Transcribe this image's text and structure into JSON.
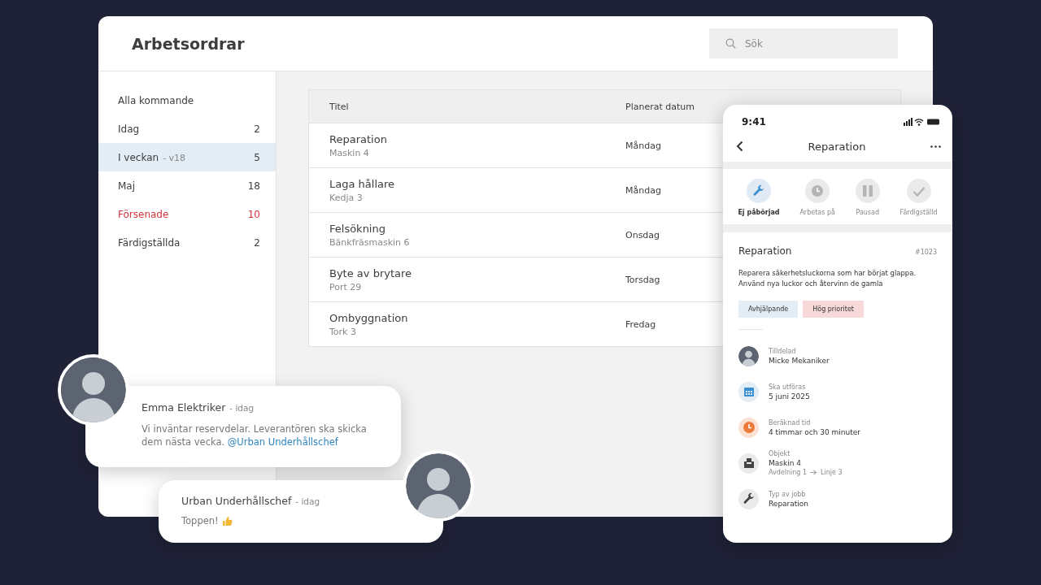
{
  "window": {
    "title": "Arbetsordrar"
  },
  "search": {
    "placeholder": "Sök"
  },
  "sidebar": {
    "items": [
      {
        "label": "Alla kommande",
        "selected": false,
        "overdue": false
      },
      {
        "label": "Idag",
        "count": "2",
        "selected": false,
        "overdue": false
      },
      {
        "label": "I veckan",
        "suffix": "- v18",
        "count": "5",
        "selected": true,
        "overdue": false
      },
      {
        "label": "Maj",
        "count": "18",
        "selected": false,
        "overdue": false
      },
      {
        "label": "Försenade",
        "count": "10",
        "selected": false,
        "overdue": true
      },
      {
        "label": "Färdigställda",
        "count": "2",
        "selected": false,
        "overdue": false
      }
    ]
  },
  "table": {
    "columns": [
      "Titel",
      "Planerat datum"
    ],
    "rows": [
      {
        "title": "Reparation",
        "object": "Maskin 4",
        "date": "Måndag"
      },
      {
        "title": "Laga hållare",
        "object": "Kedja 3",
        "date": "Måndag"
      },
      {
        "title": "Felsökning",
        "object": "Bänkfräsmaskin 6",
        "date": "Onsdag"
      },
      {
        "title": "Byte av brytare",
        "object": "Port 29",
        "date": "Torsdag"
      },
      {
        "title": "Ombyggnation",
        "object": "Tork 3",
        "date": "Fredag"
      }
    ]
  },
  "phone": {
    "time": "9:41",
    "title": "Reparation",
    "statuses": [
      {
        "kind": "wrench",
        "label": "Ej påbörjad",
        "selected": true
      },
      {
        "kind": "clock",
        "label": "Arbetas på",
        "selected": false
      },
      {
        "kind": "pause",
        "label": "Pausad",
        "selected": false
      },
      {
        "kind": "check",
        "label": "Färdigställd",
        "selected": false
      }
    ],
    "order": {
      "title": "Reparation",
      "number": "#1023",
      "description": "Reparera säkerhetsluckorna som har börjat glappa. Använd nya luckor och återvinn de gamla",
      "tags": [
        {
          "label": "Avhjälpande",
          "color": "#e3edf5"
        },
        {
          "label": "Hög prioritet",
          "color": "#f8d9da"
        }
      ]
    },
    "details": [
      {
        "kind": "person",
        "label": "Tilldelad",
        "value": "Micke Mekaniker"
      },
      {
        "kind": "calendar",
        "label": "Ska utföras",
        "value": "5 juni 2025"
      },
      {
        "kind": "clock",
        "label": "Beräknad tid",
        "value": "4 timmar och 30 minuter"
      },
      {
        "kind": "box",
        "label": "Objekt",
        "value": "Maskin 4",
        "path": [
          "Avdelning 1",
          "Linje 3"
        ]
      },
      {
        "kind": "wrench",
        "label": "Typ av jobb",
        "value": "Reparation"
      }
    ]
  },
  "comments": [
    {
      "author": "Emma Elektriker",
      "time": "- idag",
      "text": "Vi inväntar reservdelar. Leverantören ska skicka dem nästa vecka.",
      "mention": "@Urban Underhållschef",
      "thumbs_up": false
    },
    {
      "author": "Urban Underhållschef",
      "time": "- idag",
      "text": "Toppen!",
      "thumbs_up": true
    }
  ]
}
